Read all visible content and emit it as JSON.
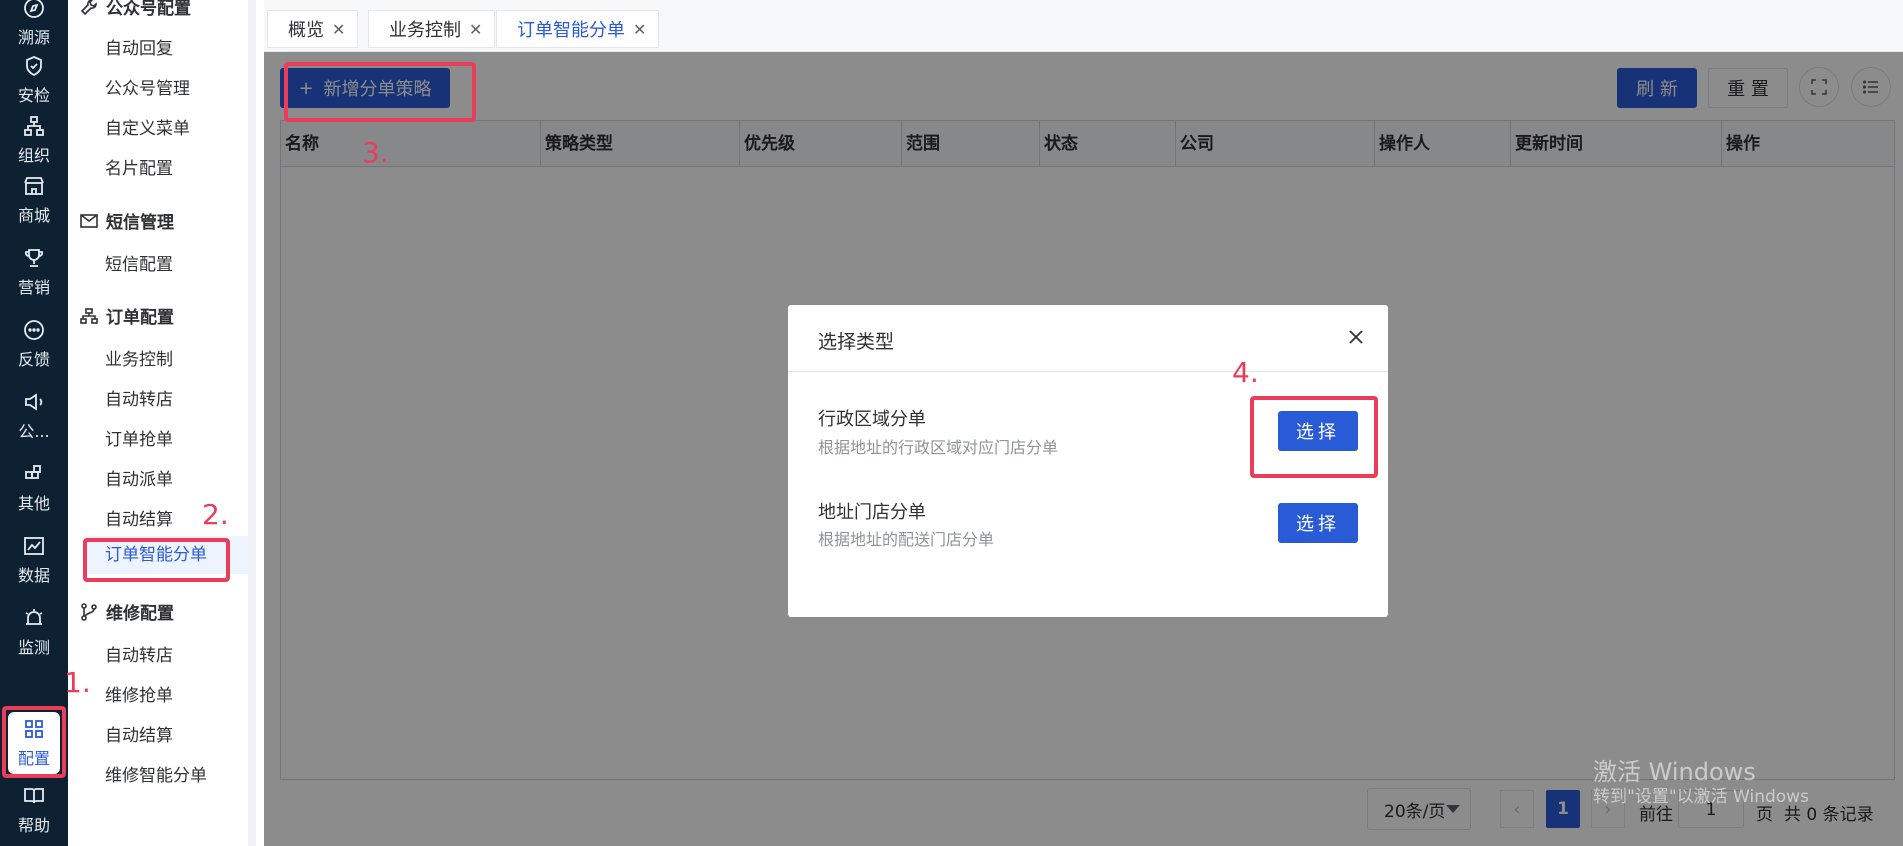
{
  "rail": {
    "items": [
      {
        "label": "溯源",
        "icon": "compass-icon"
      },
      {
        "label": "安检",
        "icon": "shield-icon"
      },
      {
        "label": "组织",
        "icon": "org-tree-icon"
      },
      {
        "label": "商城",
        "icon": "store-icon"
      },
      {
        "label": "营销",
        "icon": "trophy-icon"
      },
      {
        "label": "反馈",
        "icon": "chat-icon"
      },
      {
        "label": "公...",
        "icon": "megaphone-icon"
      },
      {
        "label": "其他",
        "icon": "blocks-icon"
      },
      {
        "label": "数据",
        "icon": "chart-icon"
      },
      {
        "label": "监测",
        "icon": "alarm-icon"
      },
      {
        "label": "配置",
        "icon": "grid-icon"
      },
      {
        "label": "帮助",
        "icon": "book-icon"
      }
    ]
  },
  "submenu": {
    "group_official": "公众号配置",
    "official_items": [
      "自动回复",
      "公众号管理",
      "自定义菜单",
      "名片配置"
    ],
    "group_sms": "短信管理",
    "sms_items": [
      "短信配置"
    ],
    "group_order": "订单配置",
    "order_items": [
      "业务控制",
      "自动转店",
      "订单抢单",
      "自动派单",
      "自动结算",
      "订单智能分单"
    ],
    "group_repair": "维修配置",
    "repair_items": [
      "自动转店",
      "维修抢单",
      "自动结算",
      "维修智能分单"
    ]
  },
  "tabs": [
    {
      "label": "概览"
    },
    {
      "label": "业务控制"
    },
    {
      "label": "订单智能分单"
    }
  ],
  "toolbar": {
    "add_label": "新增分单策略",
    "refresh_label": "刷 新",
    "reset_label": "重 置"
  },
  "table": {
    "headers": [
      "名称",
      "策略类型",
      "优先级",
      "范围",
      "状态",
      "公司",
      "操作人",
      "更新时间",
      "操作"
    ]
  },
  "pagination": {
    "page_size": "20条/页",
    "current_page": "1",
    "goto_prefix": "前往",
    "goto_value": "1",
    "goto_suffix": "页",
    "total": "共 0 条记录"
  },
  "modal": {
    "title": "选择类型",
    "options": [
      {
        "title": "行政区域分单",
        "desc": "根据地址的行政区域对应门店分单",
        "button": "选择"
      },
      {
        "title": "地址门店分单",
        "desc": "根据地址的配送门店分单",
        "button": "选择"
      }
    ]
  },
  "annotations": {
    "a1": "1.",
    "a2": "2.",
    "a3": "3.",
    "a4": "4.",
    "color": "#ea3d5a"
  },
  "watermark": {
    "line1": "激活 Windows",
    "line2": "转到\"设置\"以激活 Windows"
  },
  "colors": {
    "primary": "#2a5bd7",
    "rail_bg": "#0e2133"
  }
}
